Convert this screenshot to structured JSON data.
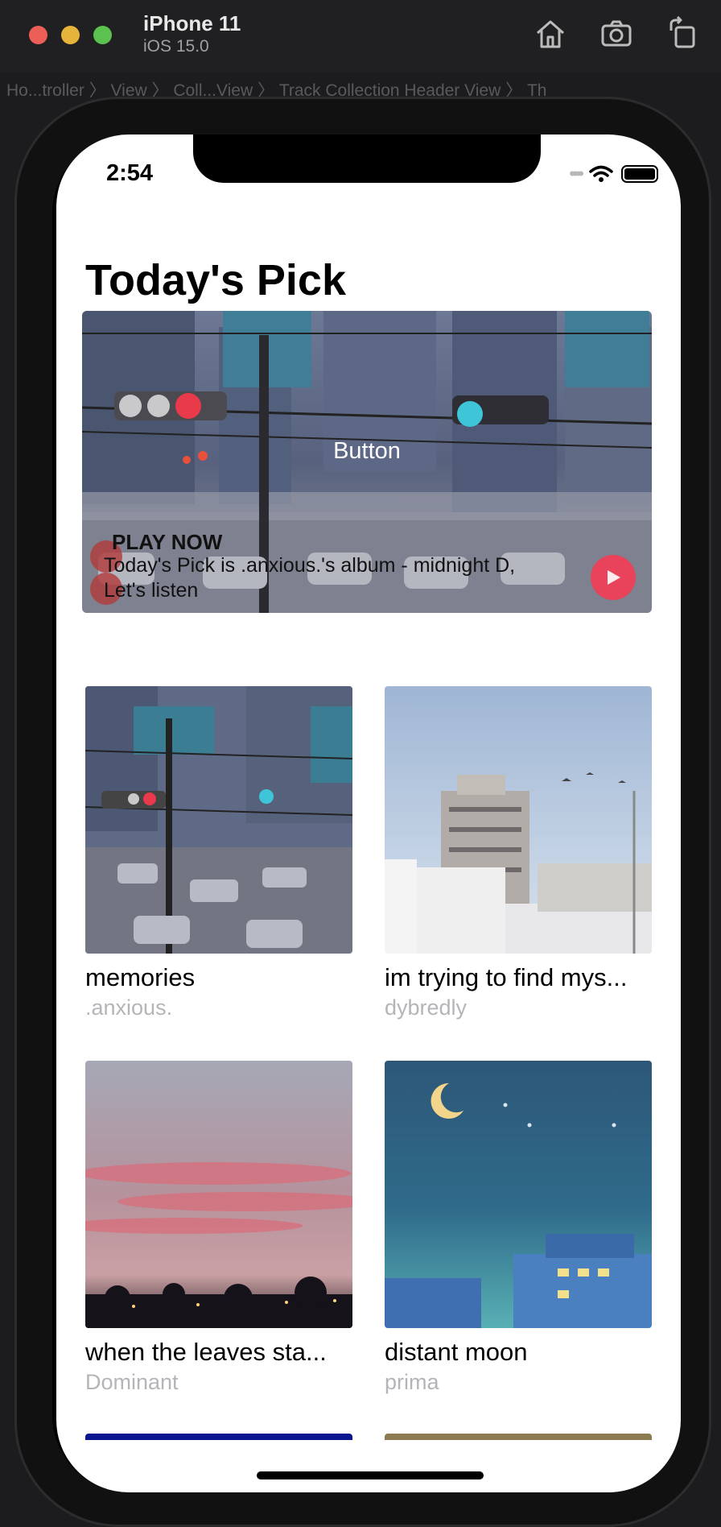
{
  "simulator": {
    "device_name": "iPhone 11",
    "os_version": "iOS 15.0",
    "breadcrumb": "Ho...troller 〉 View 〉 Coll...View 〉 Track Collection Header View 〉 Th"
  },
  "status_bar": {
    "time": "2:54"
  },
  "page": {
    "title": "Today's Pick"
  },
  "hero": {
    "button_label": "Button",
    "play_now": "PLAY NOW",
    "description": "Today's Pick is .anxious.'s album  - midnight D, Let's listen",
    "accent_color": "#e9425b"
  },
  "tracks": [
    {
      "title": "memories",
      "artist": ".anxious."
    },
    {
      "title": "im trying to find mys...",
      "artist": "dybredly"
    },
    {
      "title": "when the leaves sta...",
      "artist": "Dominant"
    },
    {
      "title": "distant moon",
      "artist": "prima"
    }
  ],
  "icons": [
    "home-icon",
    "camera-icon",
    "rotate-icon",
    "wifi-icon",
    "battery-icon",
    "play-icon"
  ]
}
